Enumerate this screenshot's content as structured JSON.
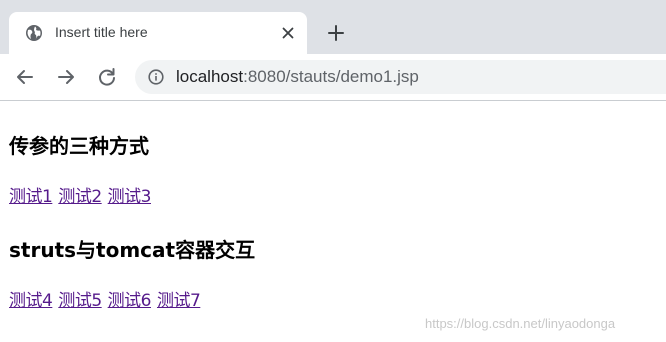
{
  "browser": {
    "tab": {
      "title": "Insert title here",
      "favicon": "globe-icon",
      "close": "close-icon"
    },
    "new_tab": "plus-icon",
    "nav": {
      "back": "arrow-left-icon",
      "forward": "arrow-right-icon",
      "reload": "reload-icon"
    },
    "omnibox": {
      "icon": "info-icon",
      "url_host": "localhost",
      "url_rest": ":8080/stauts/demo1.jsp"
    }
  },
  "page": {
    "heading1": "传参的三种方式",
    "links1": [
      "测试1",
      "测试2",
      "测试3"
    ],
    "heading2": "struts与tomcat容器交互",
    "links2": [
      "测试4",
      "测试5",
      "测试6",
      "测试7"
    ]
  },
  "watermark": "https://blog.csdn.net/linyaodonga",
  "colors": {
    "tabstrip": "#dee1e6",
    "omnibox": "#f1f3f4",
    "link_visited": "#551a8b"
  }
}
